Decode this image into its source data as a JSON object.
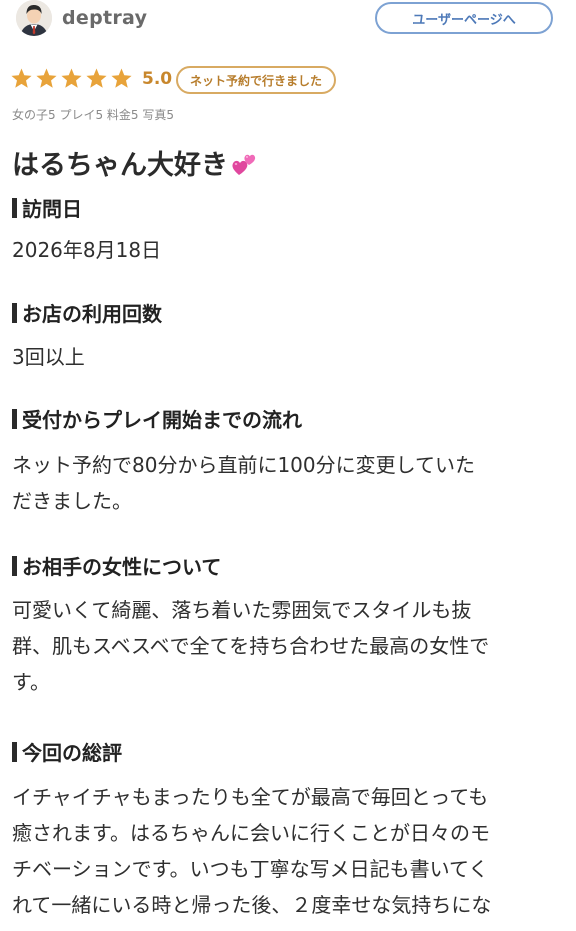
{
  "header": {
    "username": "deptray",
    "user_page_button": "ユーザーページへ",
    "avatar_icon": "user-avatar-icon"
  },
  "rating": {
    "stars": 5,
    "score": "5.0",
    "visit_badge": "ネット予約で行きました",
    "star_color": "#e8a33a",
    "subscores": "女の子5 プレイ5 料金5 写真5"
  },
  "review": {
    "title": "はるちゃん大好き",
    "title_emoji_icon": "two-hearts-icon"
  },
  "sections": {
    "visit_date": {
      "heading": "訪問日",
      "body": "2026年8月18日"
    },
    "visit_count": {
      "heading": "お店の利用回数",
      "body": "3回以上"
    },
    "flow": {
      "heading": "受付からプレイ開始までの流れ",
      "lines": [
        "ネット予約で80分から直前に100分に変更していた",
        "だきました。"
      ]
    },
    "about_her": {
      "heading": "お相手の女性について",
      "lines": [
        "可愛いくて綺麗、落ち着いた雰囲気でスタイルも抜",
        "群、肌もスベスベで全てを持ち合わせた最高の女性で",
        "す。"
      ]
    },
    "overall": {
      "heading": "今回の総評",
      "lines": [
        "イチャイチャもまったりも全てが最高で毎回とっても",
        "癒されます。はるちゃんに会いに行くことが日々のモ",
        "チベーションです。いつも丁寧な写メ日記も書いてく",
        "れて一緒にいる時と帰った後、２度幸せな気持ちにな"
      ]
    }
  }
}
